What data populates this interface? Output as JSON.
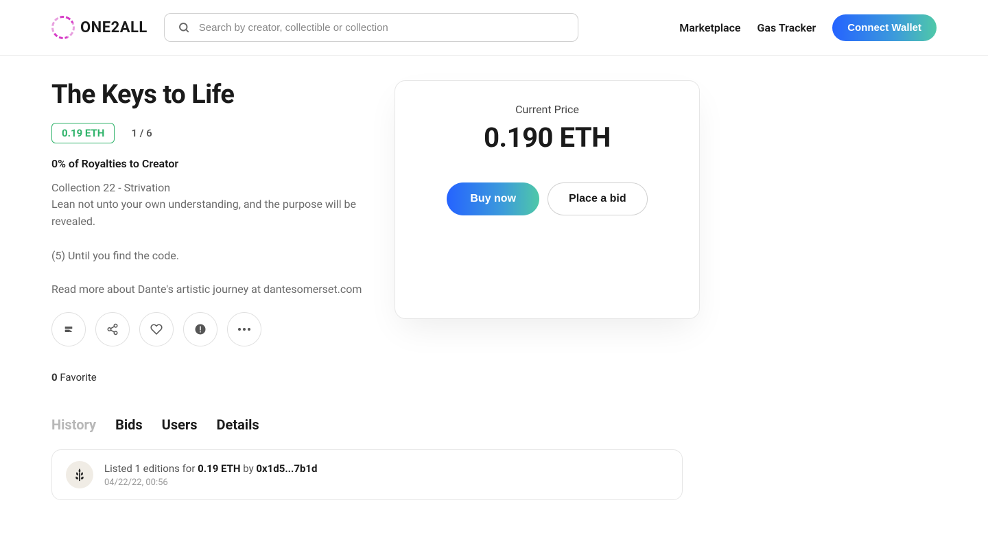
{
  "header": {
    "logo_text": "ONE2ALL",
    "search_placeholder": "Search by creator, collectible or collection",
    "nav": {
      "marketplace": "Marketplace",
      "gas_tracker": "Gas Tracker",
      "connect_wallet": "Connect Wallet"
    }
  },
  "item": {
    "title": "The Keys to Life",
    "price_badge": "0.19 ETH",
    "edition": "1 / 6",
    "royalty": "0% of Royalties to Creator",
    "description": "Collection 22 - Strivation\nLean not unto your own understanding, and the purpose will be revealed.\n\n(5) Until you find the code.\n\nRead more about Dante's artistic journey at dantesomerset.com",
    "favorites_count": "0",
    "favorites_label": " Favorite"
  },
  "price_card": {
    "label": "Current Price",
    "value": "0.190 ETH",
    "buy": "Buy now",
    "bid": "Place a bid"
  },
  "tabs": {
    "history": "History",
    "bids": "Bids",
    "users": "Users",
    "details": "Details"
  },
  "history": {
    "text_prefix": "Listed 1 editions for ",
    "price": "0.19 ETH",
    "by": " by ",
    "address": "0x1d5...7b1d",
    "date": "04/22/22, 00:56"
  }
}
